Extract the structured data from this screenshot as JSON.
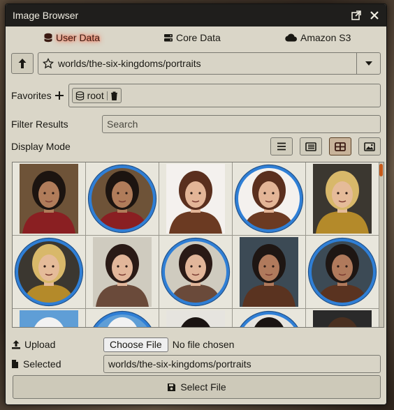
{
  "window": {
    "title": "Image Browser"
  },
  "tabs": [
    {
      "label": "User Data",
      "icon": "database-icon",
      "active": true
    },
    {
      "label": "Core Data",
      "icon": "server-icon",
      "active": false
    },
    {
      "label": "Amazon S3",
      "icon": "cloud-icon",
      "active": false
    }
  ],
  "path": {
    "value": "worlds/the-six-kingdoms/portraits"
  },
  "favorites": {
    "label": "Favorites",
    "items": [
      {
        "label": "root"
      }
    ]
  },
  "filter": {
    "label": "Filter Results",
    "placeholder": "Search"
  },
  "display_mode": {
    "label": "Display Mode",
    "modes": [
      "list",
      "thumbs",
      "tiles",
      "images"
    ],
    "active": "tiles"
  },
  "grid": {
    "tiles": [
      {
        "name": "portrait-woman-black-hair",
        "token": false,
        "hair": "#1c1410",
        "skin": "#b07c5a",
        "outfit": "#8a1f22",
        "bg": "#6e5338"
      },
      {
        "name": "token-woman-black-hair",
        "token": true,
        "hair": "#1c1410",
        "skin": "#b07c5a",
        "outfit": "#8a1f22",
        "bg": "#6e5338"
      },
      {
        "name": "portrait-elf-swordswoman",
        "token": false,
        "hair": "#5a2f1e",
        "skin": "#e3b597",
        "outfit": "#6b3a22",
        "bg": "#f4f1ee"
      },
      {
        "name": "token-elf-swordswoman",
        "token": true,
        "hair": "#5a2f1e",
        "skin": "#e3b597",
        "outfit": "#6b3a22",
        "bg": "#f4f1ee"
      },
      {
        "name": "portrait-blonde-warrior",
        "token": false,
        "hair": "#d8b86a",
        "skin": "#e5bb99",
        "outfit": "#b48a2a",
        "bg": "#3b3730"
      },
      {
        "name": "token-blonde-warrior",
        "token": true,
        "hair": "#d8b86a",
        "skin": "#e5bb99",
        "outfit": "#b48a2a",
        "bg": "#3b3730"
      },
      {
        "name": "portrait-young-man-dark-hair",
        "token": false,
        "hair": "#2a1a16",
        "skin": "#e2b69a",
        "outfit": "#6a4a3a",
        "bg": "#cfcbbf"
      },
      {
        "name": "token-young-man-dark-hair",
        "token": true,
        "hair": "#2a1a16",
        "skin": "#e2b69a",
        "outfit": "#6a4a3a",
        "bg": "#cfcbbf"
      },
      {
        "name": "portrait-bearded-rogue",
        "token": false,
        "hair": "#1e1613",
        "skin": "#b07a5c",
        "outfit": "#5a3320",
        "bg": "#3c4a55"
      },
      {
        "name": "token-bearded-rogue",
        "token": true,
        "hair": "#1e1613",
        "skin": "#b07a5c",
        "outfit": "#5a3320",
        "bg": "#3c4a55"
      },
      {
        "name": "portrait-white-haired-mage",
        "token": false,
        "hair": "#f2f2f2",
        "skin": "#e8c3a8",
        "outfit": "#7aa6d8",
        "bg": "#5f9ed6"
      },
      {
        "name": "token-white-haired-mage",
        "token": true,
        "hair": "#f2f2f2",
        "skin": "#e8c3a8",
        "outfit": "#7aa6d8",
        "bg": "#5f9ed6"
      },
      {
        "name": "portrait-topknot-man",
        "token": false,
        "hair": "#1a1412",
        "skin": "#d9a886",
        "outfit": "#444",
        "bg": "#e6e4df"
      },
      {
        "name": "token-topknot-man",
        "token": true,
        "hair": "#1a1412",
        "skin": "#d9a886",
        "outfit": "#444",
        "bg": "#e6e4df"
      },
      {
        "name": "portrait-brown-haired-man",
        "token": false,
        "hair": "#4a3020",
        "skin": "#d9ab8a",
        "outfit": "#333",
        "bg": "#2a2a2a"
      }
    ]
  },
  "upload": {
    "label": "Upload",
    "choose_file": "Choose File",
    "status": "No file chosen"
  },
  "selected": {
    "label": "Selected",
    "value": "worlds/the-six-kingdoms/portraits"
  },
  "actions": {
    "select_file": "Select File"
  },
  "colors": {
    "accent": "#ff4b2b",
    "title_bg": "#1f1e1c",
    "panel_bg": "#dad6c8",
    "token_ring": "#2f7fd6"
  }
}
